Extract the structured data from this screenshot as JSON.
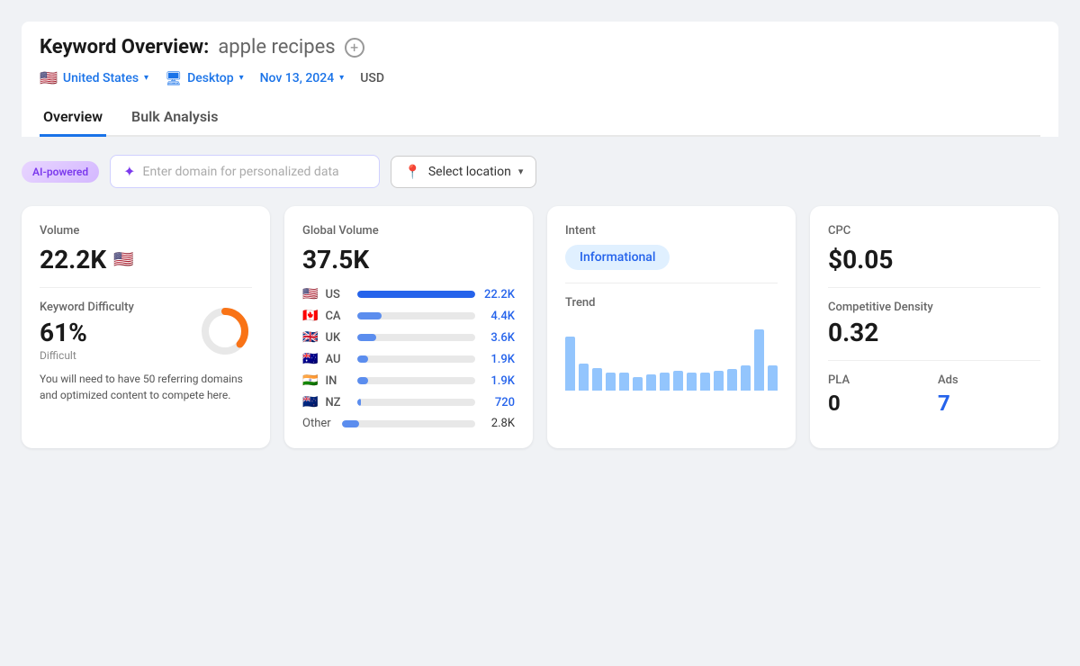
{
  "header": {
    "title_prefix": "Keyword Overview:",
    "keyword": "apple recipes",
    "location": "United States",
    "device": "Desktop",
    "date": "Nov 13, 2024",
    "currency": "USD"
  },
  "tabs": [
    {
      "label": "Overview",
      "active": true
    },
    {
      "label": "Bulk Analysis",
      "active": false
    }
  ],
  "ai_bar": {
    "badge": "AI-powered",
    "domain_placeholder": "Enter domain for personalized data",
    "location_label": "Select location"
  },
  "volume_card": {
    "label": "Volume",
    "value": "22.2K"
  },
  "kd_card": {
    "kd_label": "Keyword Difficulty",
    "kd_value": "61%",
    "kd_sublabel": "Difficult",
    "kd_desc": "You will need to have 50 referring domains and optimized content to compete here.",
    "donut_pct": 61
  },
  "global_volume_card": {
    "label": "Global Volume",
    "value": "37.5K",
    "countries": [
      {
        "flag": "us",
        "code": "US",
        "bar_pct": 100,
        "val": "22.2K",
        "dark": true
      },
      {
        "flag": "ca",
        "code": "CA",
        "bar_pct": 20,
        "val": "4.4K",
        "dark": false
      },
      {
        "flag": "uk",
        "code": "UK",
        "bar_pct": 16,
        "val": "3.6K",
        "dark": false
      },
      {
        "flag": "au",
        "code": "AU",
        "bar_pct": 9,
        "val": "1.9K",
        "dark": false
      },
      {
        "flag": "in",
        "code": "IN",
        "bar_pct": 9,
        "val": "1.9K",
        "dark": false
      },
      {
        "flag": "nz",
        "code": "NZ",
        "bar_pct": 3,
        "val": "720",
        "dark": false
      }
    ],
    "other_label": "Other",
    "other_val": "2.8K"
  },
  "intent_card": {
    "label": "Intent",
    "badge": "Informational"
  },
  "trend_card": {
    "label": "Trend",
    "bars": [
      60,
      30,
      25,
      20,
      20,
      15,
      18,
      20,
      25,
      22,
      20,
      22,
      25,
      30,
      70,
      28
    ]
  },
  "cpc_card": {
    "cpc_label": "CPC",
    "cpc_value": "$0.05",
    "comp_label": "Competitive Density",
    "comp_value": "0.32",
    "pla_label": "PLA",
    "pla_value": "0",
    "ads_label": "Ads",
    "ads_value": "7"
  }
}
